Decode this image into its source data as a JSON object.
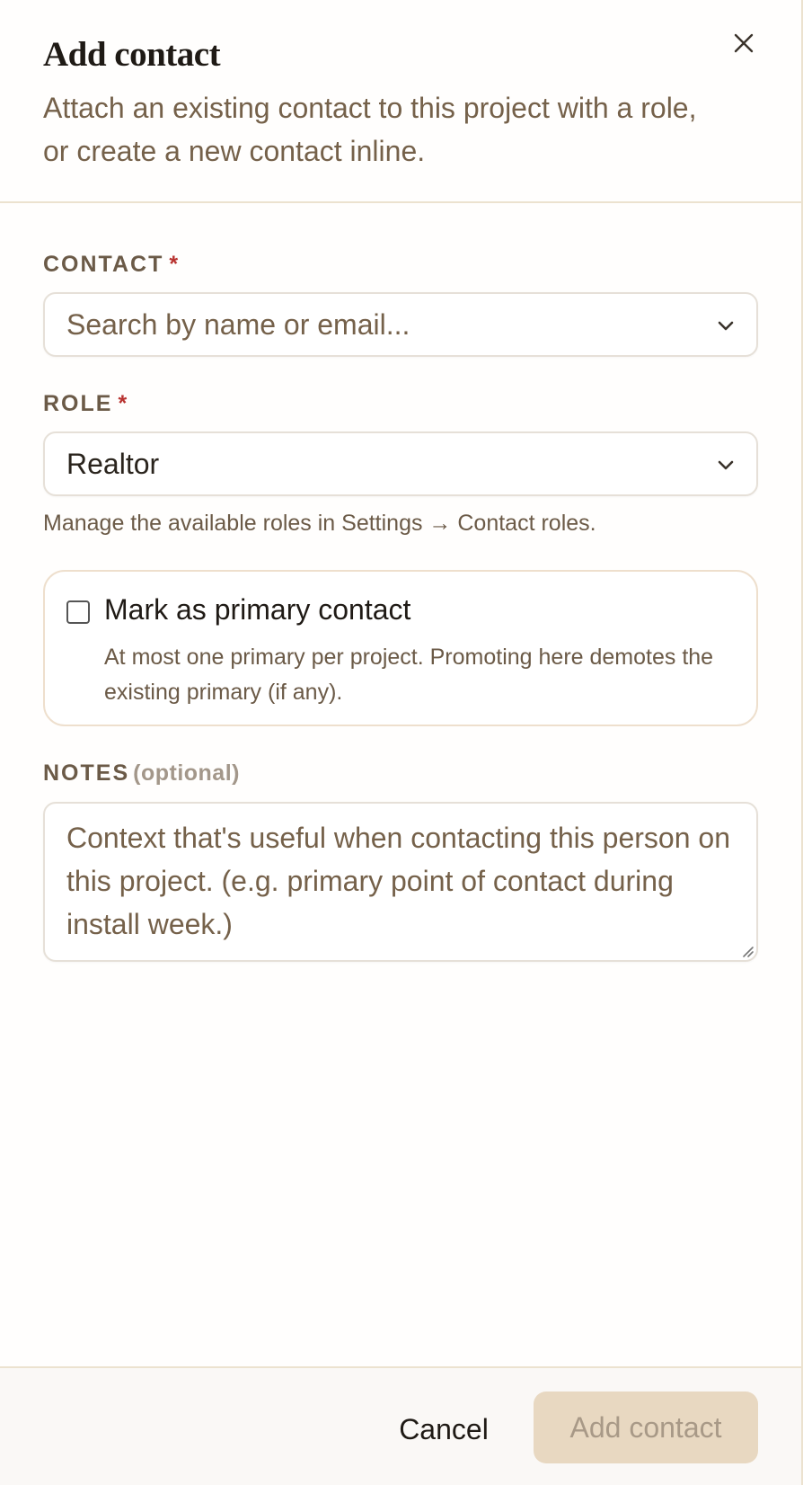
{
  "dialog": {
    "title": "Add contact",
    "subtitle": "Attach an existing contact to this project with a role, or create a new contact inline.",
    "close_icon": "close-icon"
  },
  "contact": {
    "label": "CONTACT",
    "required_mark": "*",
    "placeholder": "Search by name or email...",
    "icon": "chevron-down-icon"
  },
  "role": {
    "label": "ROLE",
    "required_mark": "*",
    "value": "Realtor",
    "icon": "chevron-down-icon",
    "hint": "Manage the available roles in Settings → Contact roles."
  },
  "primary": {
    "checked": false,
    "title": "Mark as primary contact",
    "description": "At most one primary per project. Promoting here demotes the existing primary (if any)."
  },
  "notes": {
    "label": "NOTES",
    "optional": "(optional)",
    "placeholder": "Context that's useful when contacting this person on this project. (e.g. primary point of contact during install week.)"
  },
  "footer": {
    "cancel_label": "Cancel",
    "submit_label": "Add contact",
    "submit_disabled": true
  },
  "colors": {
    "accent_disabled_bg": "#e8d8c1",
    "required": "#b8322f",
    "muted_text": "#75614a",
    "border": "#ece2cf"
  }
}
